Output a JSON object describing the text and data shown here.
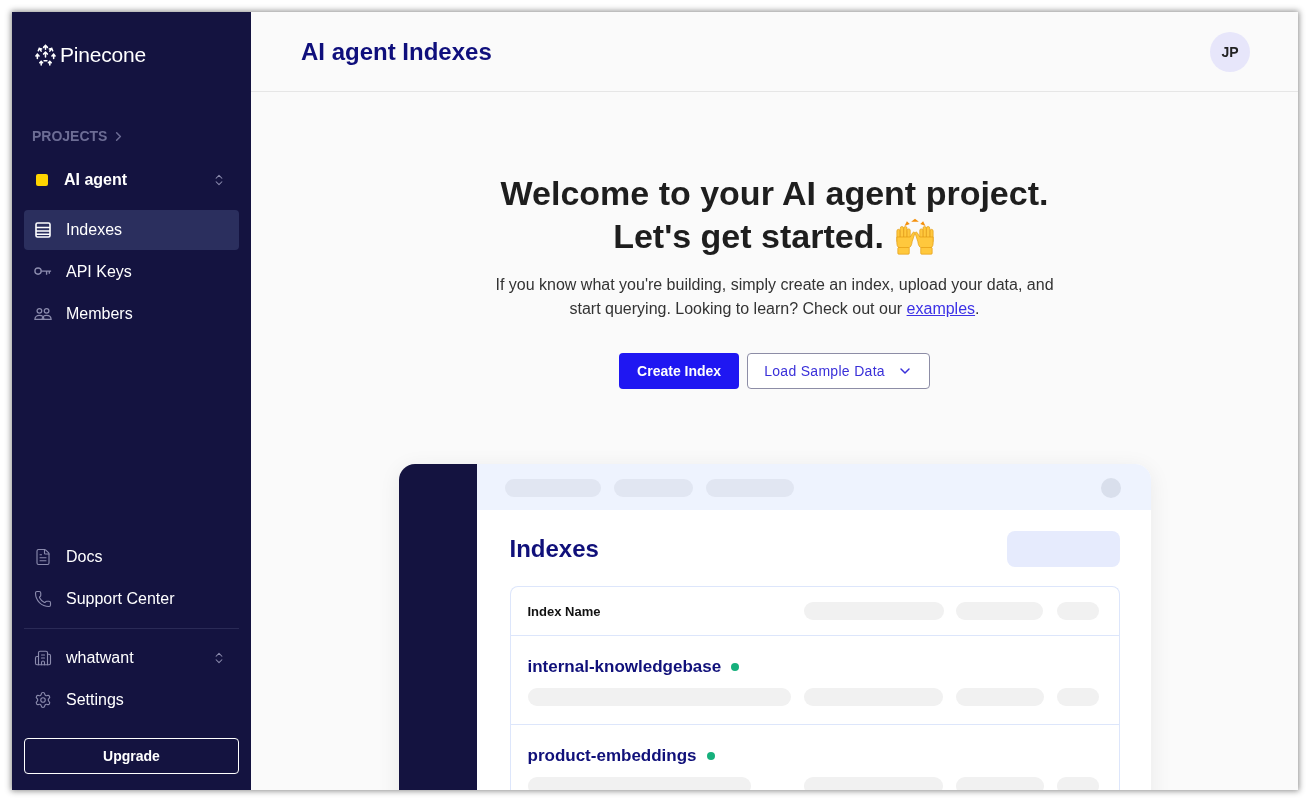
{
  "sidebar": {
    "logo": "Pinecone",
    "projects_label": "PROJECTS",
    "project": {
      "name": "AI agent",
      "color": "#ffd500"
    },
    "nav_items": [
      {
        "label": "Indexes",
        "selected": true
      },
      {
        "label": "API Keys",
        "selected": false
      },
      {
        "label": "Members",
        "selected": false
      }
    ],
    "help_links": [
      "Docs",
      "Support Center"
    ],
    "organization": "whatwant",
    "settings": "Settings",
    "upgrade_button": "Upgrade"
  },
  "header": {
    "title": "AI agent Indexes",
    "avatar": "JP"
  },
  "welcome": {
    "title_lines": [
      "Welcome to your AI agent project.",
      "Let's get started."
    ],
    "intro": {
      "text": "If you know what you're building, simply create an index, upload your data, and start querying. Looking to learn? Check out our ",
      "link": "examples",
      "after": "."
    },
    "primary_button": "Create Index",
    "secondary_button": "Load Sample Data"
  },
  "preview": {
    "title": "Indexes",
    "column_header": "Index Name",
    "rows": [
      {
        "name": "internal-knowledgebase",
        "color": "#16b07c"
      },
      {
        "name": "product-embeddings",
        "color": "#16b07c"
      }
    ]
  }
}
